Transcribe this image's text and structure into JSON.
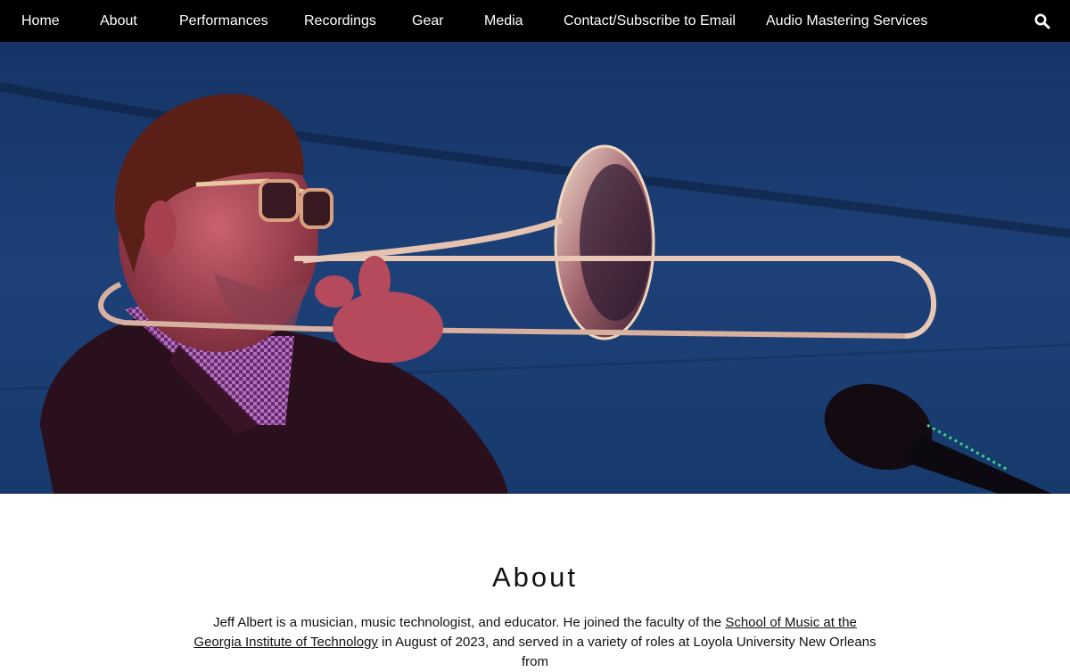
{
  "nav": {
    "items": [
      {
        "label": "Home"
      },
      {
        "label": "About"
      },
      {
        "label": "Performances"
      },
      {
        "label": "Recordings"
      },
      {
        "label": "Gear"
      },
      {
        "label": "Media"
      },
      {
        "label": "Contact/Subscribe to Email"
      },
      {
        "label": "Audio Mastering Services"
      }
    ],
    "search_icon": "search-icon"
  },
  "hero": {
    "subject": "trombone-player-photo",
    "colors": {
      "sky": "#1d3f74",
      "sky_dark": "#102851",
      "skin": "#b04a5a",
      "brass": "#e0b8a8"
    }
  },
  "about": {
    "heading": "About",
    "bio": {
      "part1": "Jeff Albert is a musician, music technologist, and educator. He joined the faculty of the ",
      "link1": "School of Music at the Georgia Institute of Technology",
      "part2": " in August of 2023, and served in a variety of roles at Loyola University New Orleans from"
    }
  }
}
